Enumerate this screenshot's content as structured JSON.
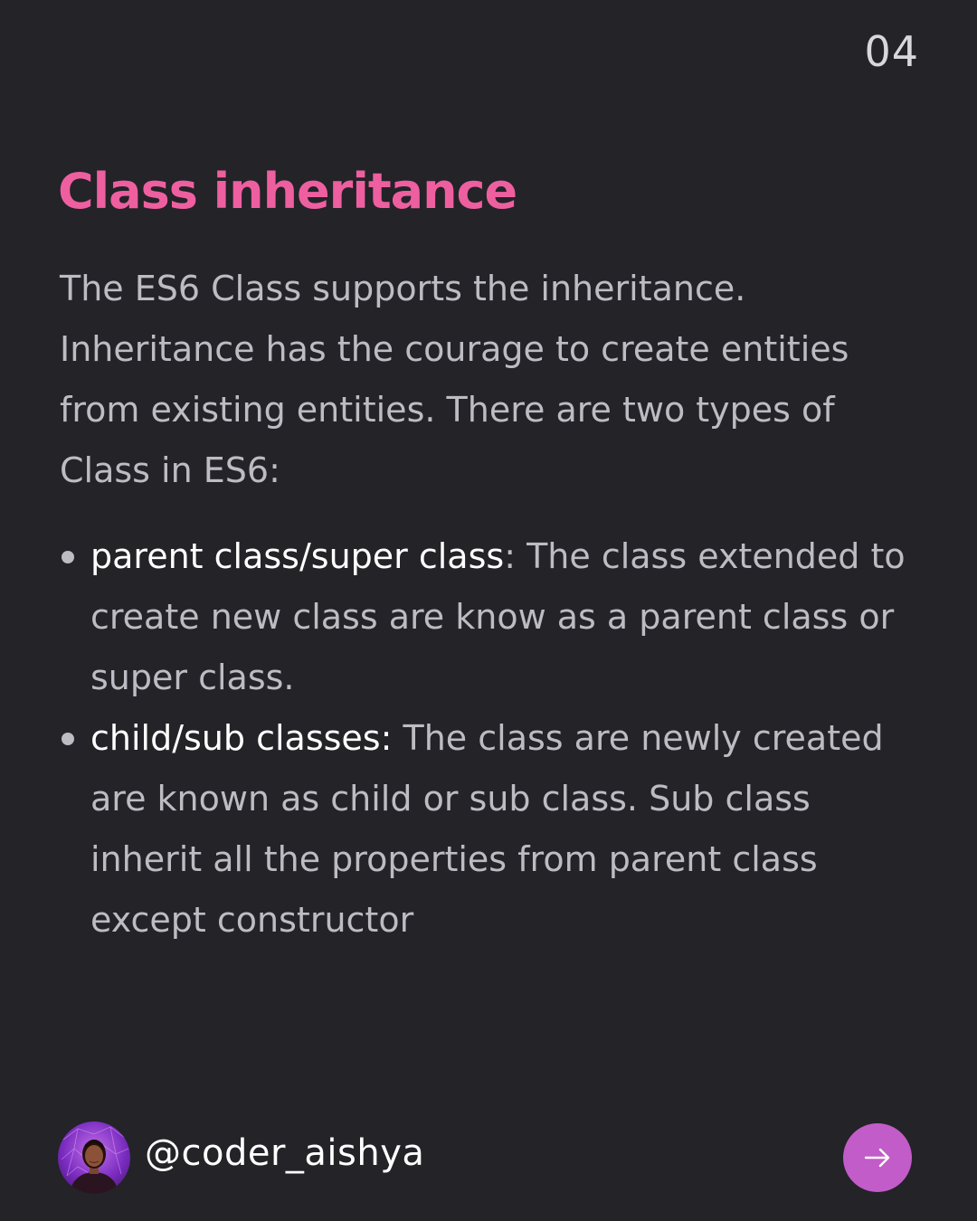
{
  "page_number": "04",
  "title": "Class inheritance",
  "intro": "The ES6 Class supports the inheritance. Inheritance has the courage to create entities from existing entities. There are two types of Class in ES6:",
  "bullets": [
    {
      "term": "parent class/super class",
      "text": ": The class extended to create new class are know as a parent class or super class."
    },
    {
      "term": "child/sub classes:",
      "text": " The class are newly created are known as child or sub class. Sub class inherit all the properties from parent class except constructor"
    }
  ],
  "footer": {
    "handle": "@coder_aishya",
    "avatar_icon": "profile-photo",
    "next_icon": "arrow-right-icon"
  },
  "colors": {
    "background": "#232328",
    "title": "#ee5fa0",
    "body_text": "#bcbcc2",
    "term_text": "#ffffff",
    "next_button": "#c25cc8"
  }
}
